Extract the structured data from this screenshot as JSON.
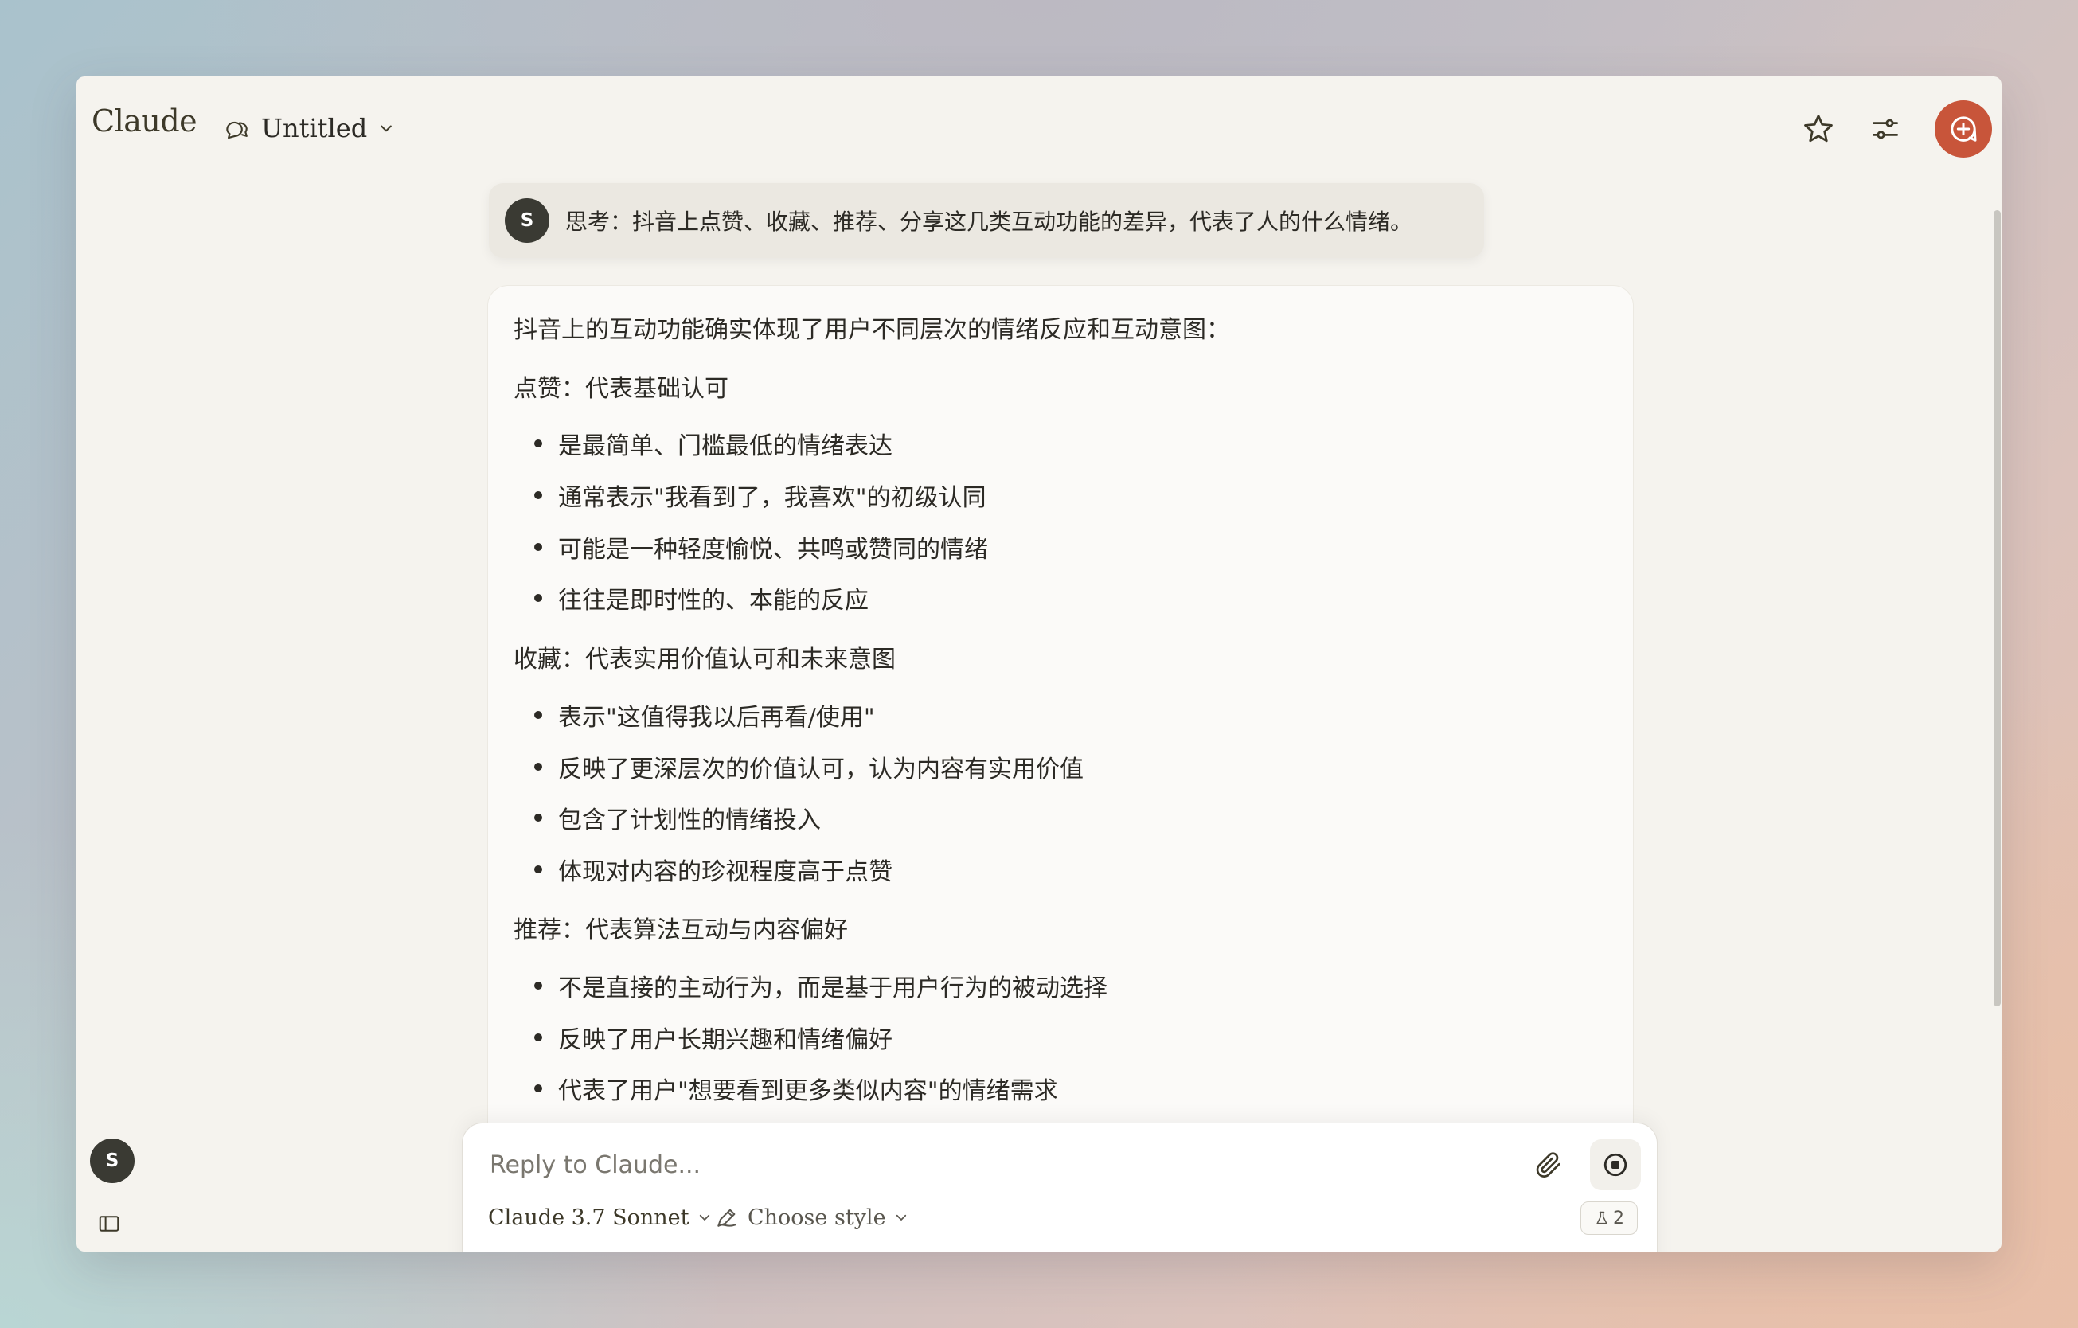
{
  "app": {
    "name": "Claude"
  },
  "header": {
    "title": "Untitled",
    "accent_color": "#c8553a"
  },
  "user_message": {
    "avatar_initial": "S",
    "text": "思考：抖音上点赞、收藏、推荐、分享这几类互动功能的差异，代表了人的什么情绪。"
  },
  "assistant_message": {
    "intro": "抖音上的互动功能确实体现了用户不同层次的情绪反应和互动意图：",
    "sections": [
      {
        "heading": "点赞：代表基础认可",
        "bullets": [
          "是最简单、门槛最低的情绪表达",
          "通常表示\"我看到了，我喜欢\"的初级认同",
          "可能是一种轻度愉悦、共鸣或赞同的情绪",
          "往往是即时性的、本能的反应"
        ]
      },
      {
        "heading": "收藏：代表实用价值认可和未来意图",
        "bullets": [
          "表示\"这值得我以后再看/使用\"",
          "反映了更深层次的价值认可，认为内容有实用价值",
          "包含了计划性的情绪投入",
          "体现对内容的珍视程度高于点赞"
        ]
      },
      {
        "heading": "推荐：代表算法互动与内容偏好",
        "bullets": [
          "不是直接的主动行为，而是基于用户行为的被动选择",
          "反映了用户长期兴趣和情绪偏好",
          "代表了用户\"想要看到更多类似内容\"的情绪需求"
        ]
      }
    ]
  },
  "composer": {
    "placeholder": "Reply to Claude...",
    "model_label": "Claude 3.7 Sonnet",
    "style_label": "Choose style",
    "badge_count": "2"
  },
  "sidebar": {
    "avatar_initial": "S"
  },
  "icons": {
    "chat": "chat-bubbles-icon",
    "star": "star-icon",
    "settings": "sliders-icon",
    "new_chat": "chat-plus-icon",
    "attach": "paperclip-icon",
    "stop": "stop-icon",
    "style": "pen-icon",
    "flask": "flask-icon",
    "sidebar": "sidebar-toggle-icon"
  }
}
